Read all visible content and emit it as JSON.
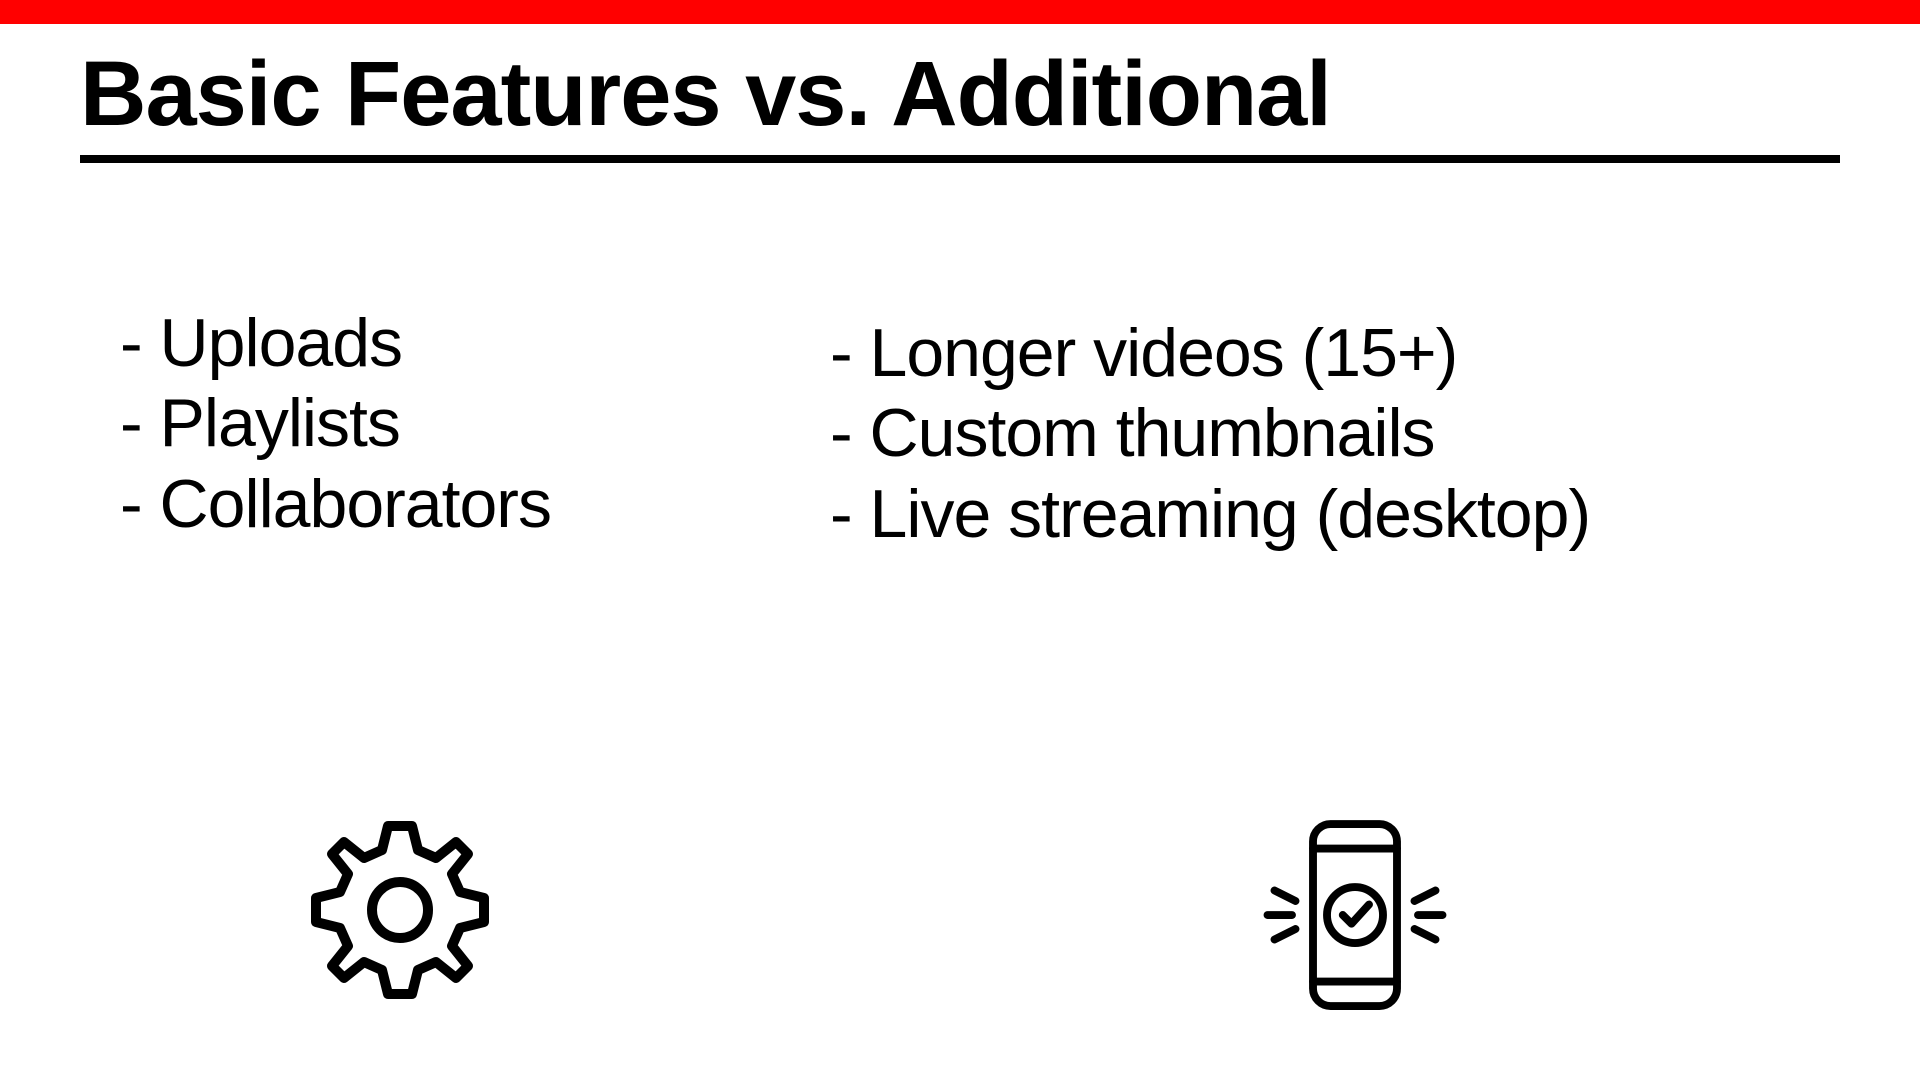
{
  "accent_color": "#ff0000",
  "title": "Basic Features vs. Additional",
  "left": {
    "items": [
      "- Uploads",
      "- Playlists",
      "- Collaborators"
    ]
  },
  "right": {
    "items": [
      "- Longer videos (15+)",
      "- Custom thumbnails",
      "- Live streaming (desktop)"
    ]
  }
}
